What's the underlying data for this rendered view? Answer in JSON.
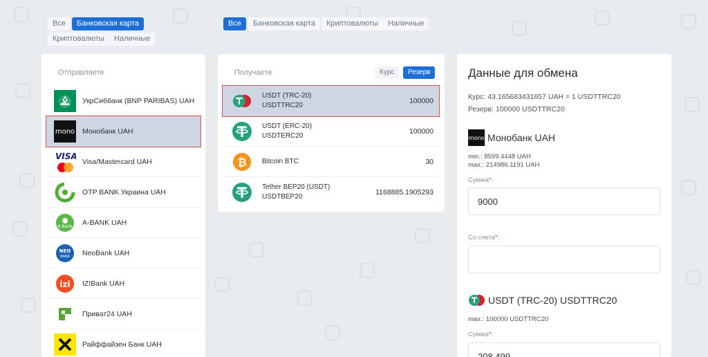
{
  "send_filters": [
    "Все",
    "Банковская карта",
    "Криптовалюты",
    "Наличные"
  ],
  "send_filters_active": 1,
  "recv_filters": [
    "Все",
    "Банковская карта",
    "Криптовалюты",
    "Наличные"
  ],
  "recv_filters_active": 0,
  "send": {
    "title": "Отправляете",
    "items": [
      {
        "label": "УкрСиббанк (BNP PARIBAS) UAH",
        "icon": "ukrsibbank-logo"
      },
      {
        "label": "Монобанк UAH",
        "icon": "monobank-logo",
        "logo_text": "mono"
      },
      {
        "label": "Visa/Mastercard UAH",
        "icon": "visa-mastercard-logo",
        "logo_text": "VISA"
      },
      {
        "label": "OTP BANK Украина UAH",
        "icon": "otp-bank-logo"
      },
      {
        "label": "A-BANK UAH",
        "icon": "a-bank-logo",
        "logo_text": "A-Bank"
      },
      {
        "label": "NeoBank UAH",
        "icon": "neobank-logo",
        "logo_text": "NEO BANK"
      },
      {
        "label": "IZIBank UAH",
        "icon": "izibank-logo",
        "logo_text": "izi"
      },
      {
        "label": "Приват24 UAH",
        "icon": "privat24-logo"
      },
      {
        "label": "Райффайзен Банк UAH",
        "icon": "raiffeisen-logo"
      }
    ],
    "selected_index": 1
  },
  "receive": {
    "title": "Получаете",
    "toggle_rate": "Курс",
    "toggle_reserve": "Резерв",
    "items": [
      {
        "name": "USDT (TRC-20)",
        "code": "USDTTRC20",
        "amount": "100000",
        "icon": "usdt-trc20-icon"
      },
      {
        "name": "USDT (ERC-20)",
        "code": "USDTERC20",
        "amount": "100000",
        "icon": "usdt-erc20-icon"
      },
      {
        "name": "Bitcoin BTC",
        "code": "",
        "amount": "30",
        "icon": "bitcoin-icon"
      },
      {
        "name": "Tether BEP20 (USDT)",
        "code": "USDTBEP20",
        "amount": "1168885.1905293",
        "icon": "tether-bep20-icon"
      }
    ],
    "selected_index": 0
  },
  "exchange": {
    "title": "Данные для обмена",
    "rate_label": "Курс:",
    "rate_value": "43.165683431657 UAH = 1 USDTTRC20",
    "reserve_label": "Резерв:",
    "reserve_value": "100000 USDTTRC20",
    "give": {
      "logo_text": "mono",
      "title": "Монобанк UAH",
      "min": "min.: 8599.4448 UAH",
      "max": "max.: 214986.1191 UAH",
      "sum_label": "Сумма",
      "sum_value": "9000",
      "account_label": "Со счета",
      "account_value": ""
    },
    "get": {
      "title": "USDT (TRC-20) USDTTRC20",
      "max": "max.: 100000 USDTTRC20",
      "sum_label": "Сумма",
      "sum_value": "208.499"
    },
    "required_mark": "*:"
  },
  "colors": {
    "accent": "#1d6fd6",
    "selected_bg": "#cfd6e3",
    "selected_border": "#e24b4b",
    "tether_green": "#26a17b",
    "bitcoin_orange": "#f7931a"
  }
}
